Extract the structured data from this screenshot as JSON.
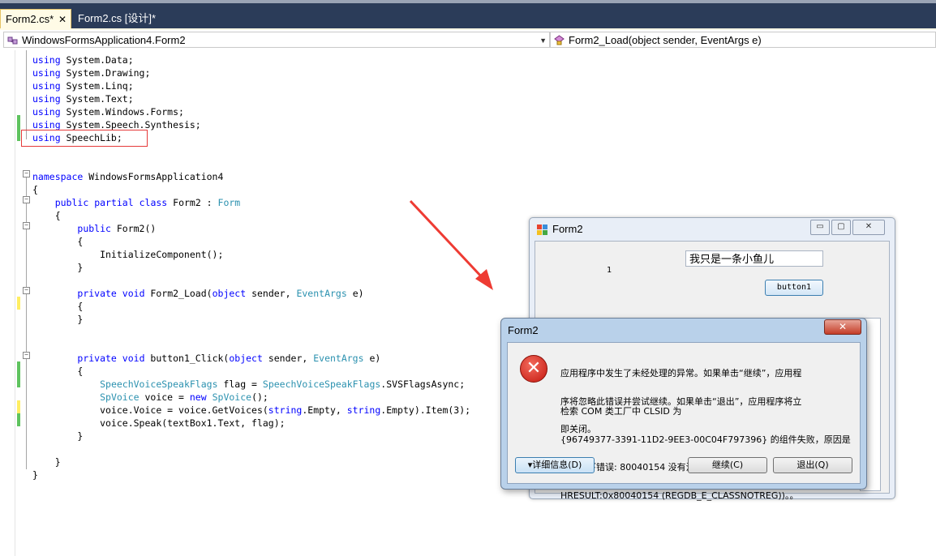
{
  "tabs": [
    {
      "label": "Form2.cs*",
      "close": "✕"
    },
    {
      "label": "Form2.cs [设计]*"
    }
  ],
  "nav": {
    "type_combo": "WindowsFormsApplication4.Form2",
    "member_combo": "Form2_Load(object sender, EventArgs e)"
  },
  "code": [
    "using System.Data;",
    "using System.Drawing;",
    "using System.Linq;",
    "using System.Text;",
    "using System.Windows.Forms;",
    "using System.Speech.Synthesis;",
    "using SpeechLib;",
    "",
    "",
    "namespace WindowsFormsApplication4",
    "{",
    "    public partial class Form2 : Form",
    "    {",
    "        public Form2()",
    "        {",
    "            InitializeComponent();",
    "        }",
    "",
    "        private void Form2_Load(object sender, EventArgs e)",
    "        {",
    "        }",
    "",
    "",
    "        private void button1_Click(object sender, EventArgs e)",
    "        {",
    "            SpeechVoiceSpeakFlags flag = SpeechVoiceSpeakFlags.SVSFlagsAsync;",
    "            SpVoice voice = new SpVoice();",
    "            voice.Voice = voice.GetVoices(string.Empty, string.Empty).Item(3);",
    "            voice.Speak(textBox1.Text, flag);",
    "        }",
    "",
    "    }",
    "}"
  ],
  "form2": {
    "title": "Form2",
    "label1": "1",
    "textbox1": "我只是一条小鱼儿",
    "button1": "button1",
    "min": "▭",
    "max": "▢",
    "close": "✕"
  },
  "dialog": {
    "title": "Form2",
    "close": "✕",
    "message_lines": [
      "应用程序中发生了未经处理的异常。如果单击“继续”，应用程",
      "序将忽略此错误并尝试继续。如果单击“退出”，应用程序将立",
      "即关闭。"
    ],
    "detail_lines": [
      "检索 COM 类工厂中 CLSID 为",
      "{96749377-3391-11D2-9EE3-00C04F797396} 的组件失败，原因是",
      "出现以下错误: 80040154 没有注册类 (异常来自",
      "HRESULT:0x80040154 (REGDB_E_CLASSNOTREG))。。"
    ],
    "details_button": "▾详细信息(D)",
    "continue_button": "继续(C)",
    "quit_button": "退出(Q)"
  }
}
